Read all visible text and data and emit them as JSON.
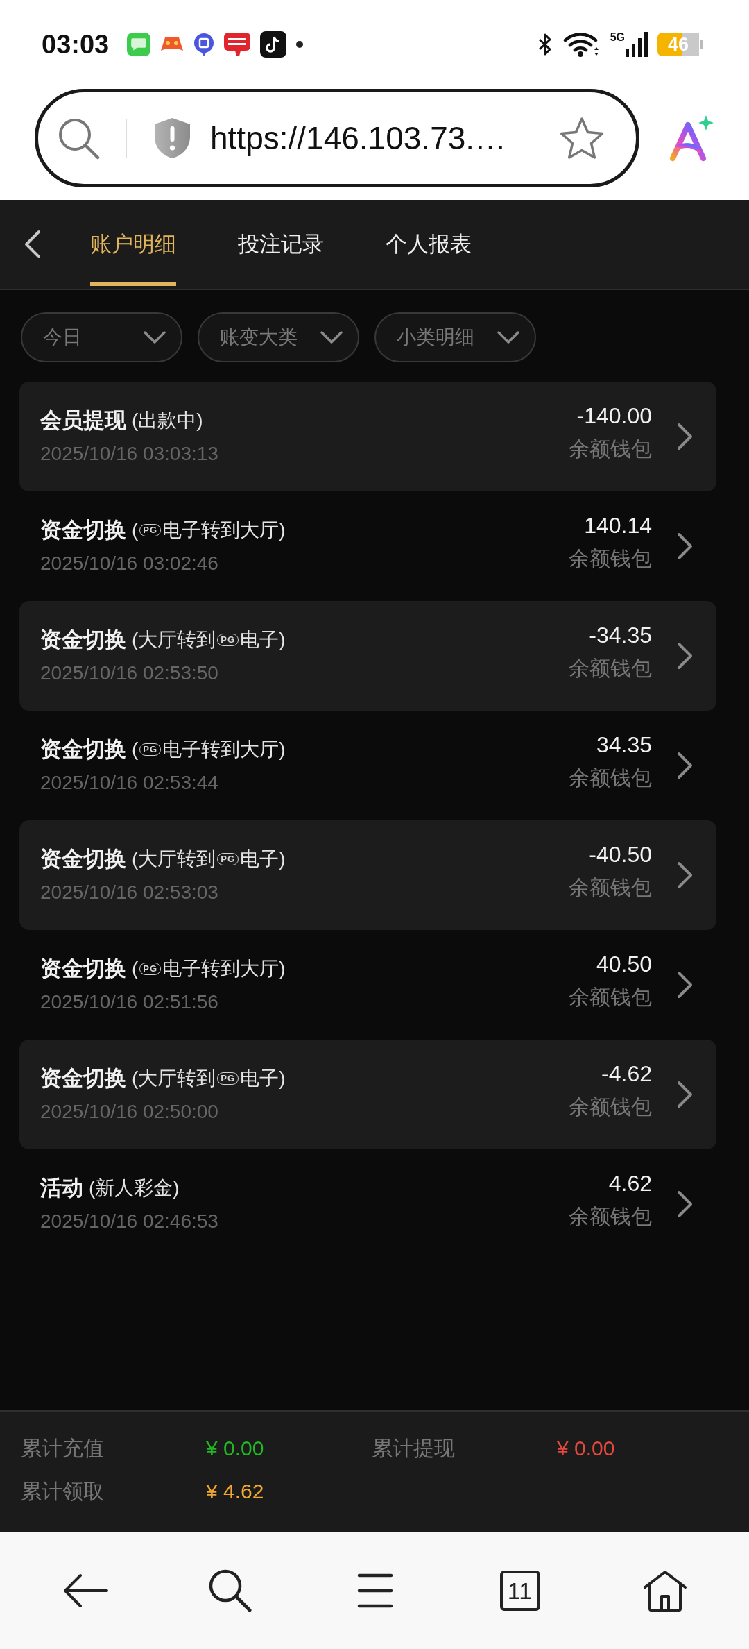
{
  "status_bar": {
    "time": "03:03",
    "network": "5G",
    "battery": "46"
  },
  "address_bar": {
    "url": "https://146.103.73.…"
  },
  "tabs": [
    {
      "label": "账户明细",
      "selected": true
    },
    {
      "label": "投注记录",
      "selected": false
    },
    {
      "label": "个人报表",
      "selected": false
    }
  ],
  "filters": [
    {
      "label": "今日"
    },
    {
      "label": "账变大类"
    },
    {
      "label": "小类明细"
    }
  ],
  "entries": [
    {
      "title": "会员提现",
      "note": [
        {
          "kind": "text",
          "text": "(出款中)"
        }
      ],
      "date": "2025/10/16 03:03:13",
      "amount": "-140.00",
      "wallet": "余额钱包"
    },
    {
      "title": "资金切换",
      "note": [
        {
          "kind": "text",
          "text": "("
        },
        {
          "kind": "logo",
          "text": "PG"
        },
        {
          "kind": "text",
          "text": "电子转到大厅)"
        }
      ],
      "date": "2025/10/16 03:02:46",
      "amount": "140.14",
      "wallet": "余额钱包"
    },
    {
      "title": "资金切换",
      "note": [
        {
          "kind": "text",
          "text": "(大厅转到"
        },
        {
          "kind": "logo",
          "text": "PG"
        },
        {
          "kind": "text",
          "text": "电子)"
        }
      ],
      "date": "2025/10/16 02:53:50",
      "amount": "-34.35",
      "wallet": "余额钱包"
    },
    {
      "title": "资金切换",
      "note": [
        {
          "kind": "text",
          "text": "("
        },
        {
          "kind": "logo",
          "text": "PG"
        },
        {
          "kind": "text",
          "text": "电子转到大厅)"
        }
      ],
      "date": "2025/10/16 02:53:44",
      "amount": "34.35",
      "wallet": "余额钱包"
    },
    {
      "title": "资金切换",
      "note": [
        {
          "kind": "text",
          "text": "(大厅转到"
        },
        {
          "kind": "logo",
          "text": "PG"
        },
        {
          "kind": "text",
          "text": "电子)"
        }
      ],
      "date": "2025/10/16 02:53:03",
      "amount": "-40.50",
      "wallet": "余额钱包"
    },
    {
      "title": "资金切换",
      "note": [
        {
          "kind": "text",
          "text": "("
        },
        {
          "kind": "logo",
          "text": "PG"
        },
        {
          "kind": "text",
          "text": "电子转到大厅)"
        }
      ],
      "date": "2025/10/16 02:51:56",
      "amount": "40.50",
      "wallet": "余额钱包"
    },
    {
      "title": "资金切换",
      "note": [
        {
          "kind": "text",
          "text": "(大厅转到"
        },
        {
          "kind": "logo",
          "text": "PG"
        },
        {
          "kind": "text",
          "text": "电子)"
        }
      ],
      "date": "2025/10/16 02:50:00",
      "amount": "-4.62",
      "wallet": "余额钱包"
    },
    {
      "title": "活动",
      "note": [
        {
          "kind": "text",
          "text": "(新人彩金)"
        }
      ],
      "date": "2025/10/16 02:46:53",
      "amount": "4.62",
      "wallet": "余额钱包"
    }
  ],
  "summary": [
    {
      "label": "累计充值",
      "value": "¥ 0.00",
      "color": "#22b822"
    },
    {
      "label": "累计提现",
      "value": "¥ 0.00",
      "color": "#e5483e"
    },
    {
      "label": "累计领取",
      "value": "¥ 4.62",
      "color": "#f0a830"
    }
  ],
  "bottom_nav": {
    "tab_count": "11"
  }
}
